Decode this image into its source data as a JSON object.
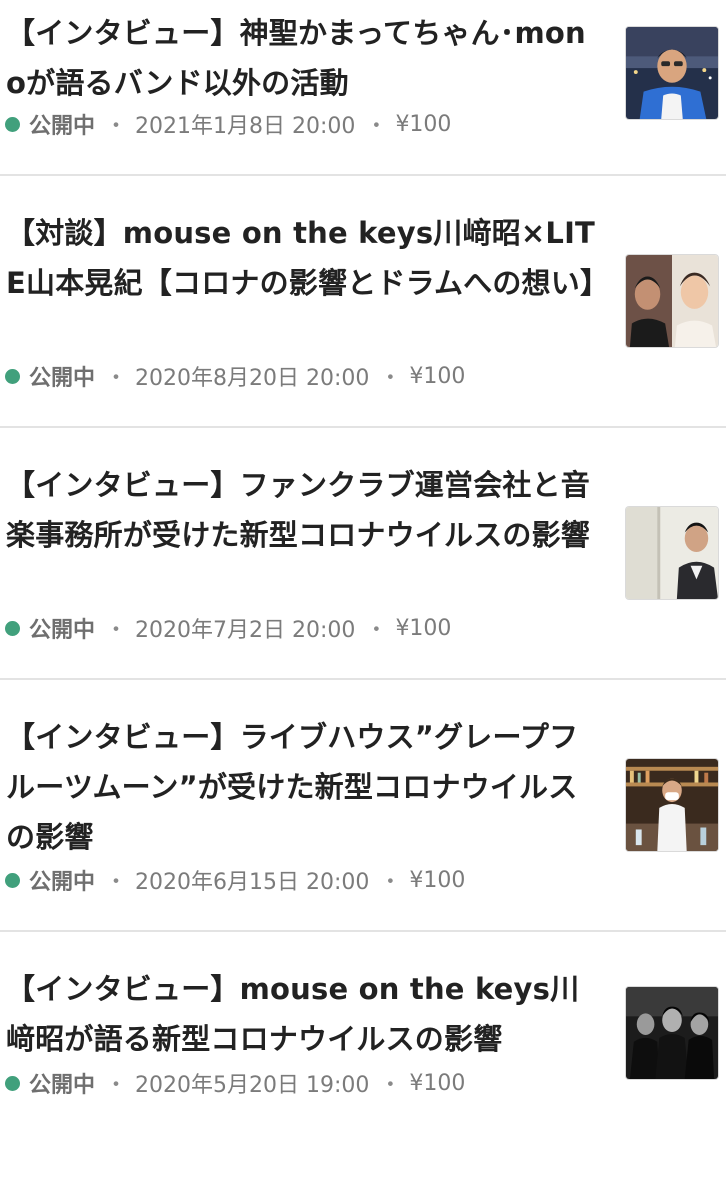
{
  "articles": [
    {
      "title": "【インタビュー】神聖かまってちゃん･mon oが語るバンド以外の活動",
      "status": "公開中",
      "date": "2021年1月8日 20:00",
      "price": "¥100",
      "status_color": "#41a07c"
    },
    {
      "title": "【対談】mouse on the keys川﨑昭×LITE山本晃紀【コロナの影響とドラムへの想い】",
      "status": "公開中",
      "date": "2020年8月20日 20:00",
      "price": "¥100",
      "status_color": "#41a07c"
    },
    {
      "title": "【インタビュー】ファンクラブ運営会社と音楽事務所が受けた新型コロナウイルスの影響",
      "status": "公開中",
      "date": "2020年7月2日 20:00",
      "price": "¥100",
      "status_color": "#41a07c"
    },
    {
      "title": "【インタビュー】ライブハウス”グレープフルーツムーン”が受けた新型コロナウイルスの影響",
      "status": "公開中",
      "date": "2020年6月15日 20:00",
      "price": "¥100",
      "status_color": "#41a07c"
    },
    {
      "title": "【インタビュー】mouse on the keys川﨑昭が語る新型コロナウイルスの影響",
      "status": "公開中",
      "date": "2020年5月20日 19:00",
      "price": "¥100",
      "status_color": "#41a07c"
    }
  ],
  "separator": "・",
  "colors": {
    "text": "#222222",
    "meta": "#7b7b7b",
    "published": "#41a07c",
    "divider": "#e3e3e3"
  },
  "icons": {
    "status": "green-dot-icon"
  }
}
